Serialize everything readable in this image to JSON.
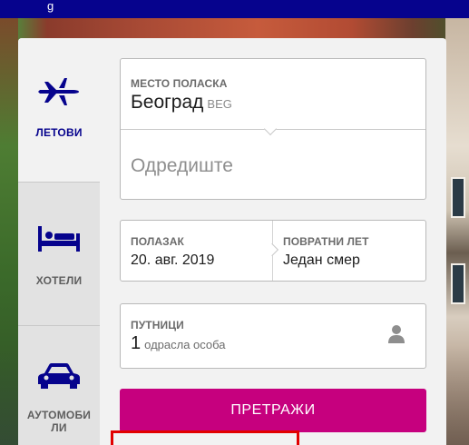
{
  "topbar": {
    "text": "g"
  },
  "tabs": [
    {
      "label": "ЛЕТОВИ",
      "icon": "airplane-icon",
      "active": true
    },
    {
      "label": "ХОТЕЛИ",
      "icon": "bed-icon",
      "active": false
    },
    {
      "label": "АУТОМОБИ ЛИ",
      "icon": "car-icon",
      "active": false
    }
  ],
  "route": {
    "origin_label": "МЕСТО ПОЛАСКА",
    "origin_value": "Београд",
    "origin_code": "BEG",
    "destination_placeholder": "Одредиште"
  },
  "dates": {
    "departure_label": "ПОЛАЗАК",
    "departure_value": "20. авг. 2019",
    "return_label": "ПОВРАТНИ ЛЕТ",
    "return_value": "Један смер"
  },
  "passengers": {
    "label": "ПУТНИЦИ",
    "count": "1",
    "type": "одрасла особа",
    "icon": "person-icon"
  },
  "search_button": {
    "label": "ПРЕТРАЖИ"
  },
  "colors": {
    "brand_blue": "#06038d",
    "search_magenta": "#c6007e",
    "highlight_red": "#e10000"
  }
}
